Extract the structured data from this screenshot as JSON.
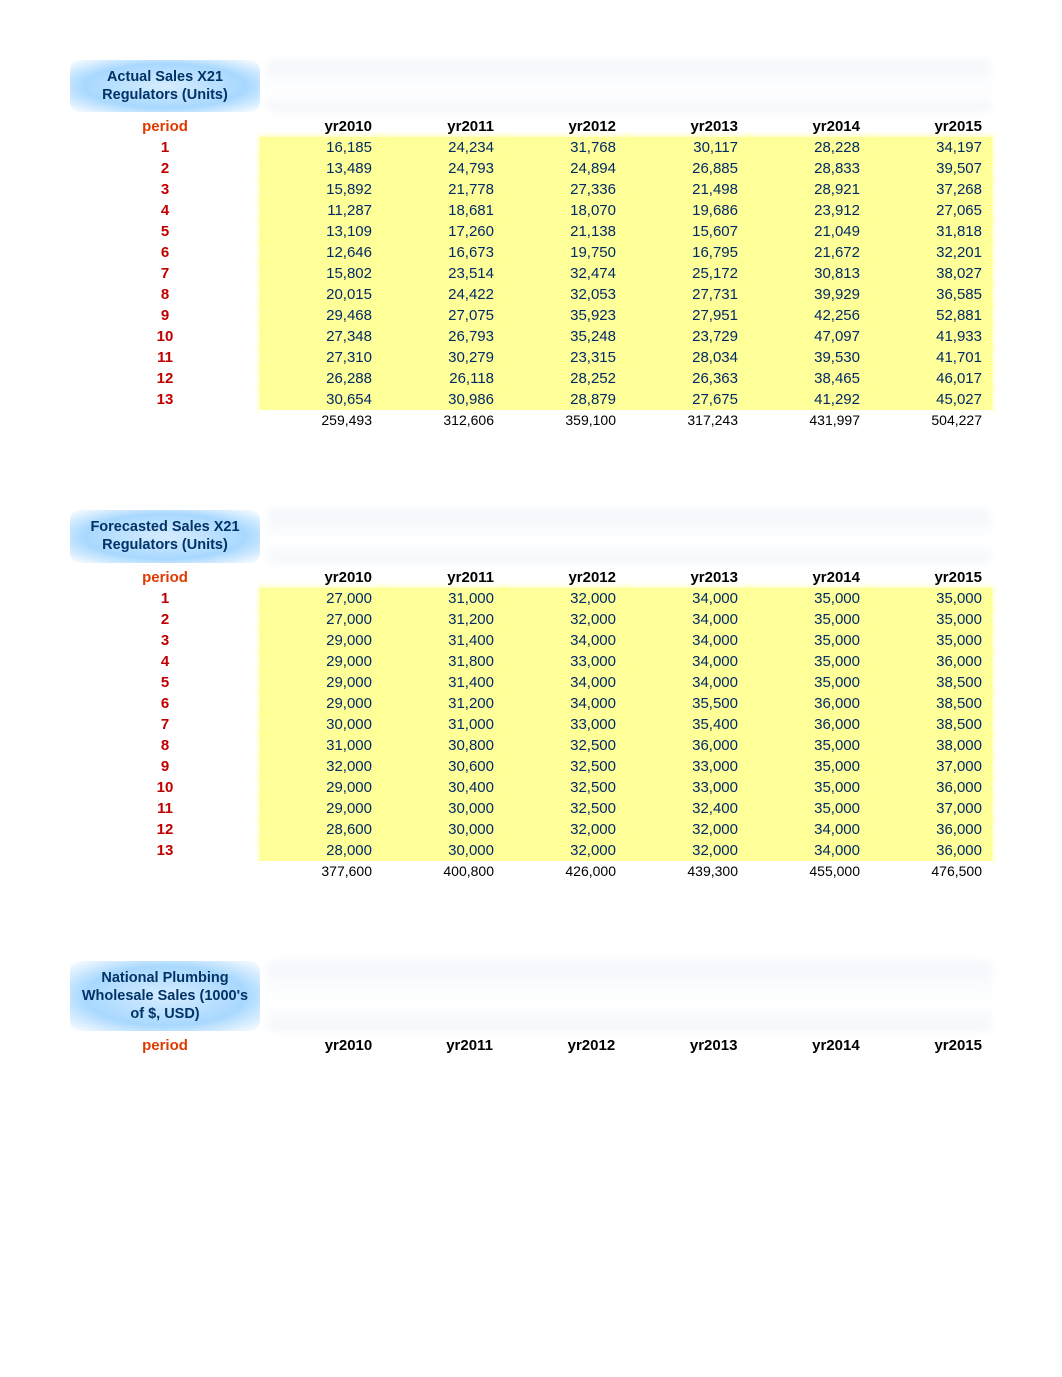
{
  "tables": [
    {
      "title": "Actual Sales X21 Regulators (Units)",
      "period_label": "period",
      "years": [
        "yr2010",
        "yr2011",
        "yr2012",
        "yr2013",
        "yr2014",
        "yr2015"
      ],
      "rows": [
        {
          "period": "1",
          "vals": [
            "16,185",
            "24,234",
            "31,768",
            "30,117",
            "28,228",
            "34,197"
          ]
        },
        {
          "period": "2",
          "vals": [
            "13,489",
            "24,793",
            "24,894",
            "26,885",
            "28,833",
            "39,507"
          ]
        },
        {
          "period": "3",
          "vals": [
            "15,892",
            "21,778",
            "27,336",
            "21,498",
            "28,921",
            "37,268"
          ]
        },
        {
          "period": "4",
          "vals": [
            "11,287",
            "18,681",
            "18,070",
            "19,686",
            "23,912",
            "27,065"
          ]
        },
        {
          "period": "5",
          "vals": [
            "13,109",
            "17,260",
            "21,138",
            "15,607",
            "21,049",
            "31,818"
          ]
        },
        {
          "period": "6",
          "vals": [
            "12,646",
            "16,673",
            "19,750",
            "16,795",
            "21,672",
            "32,201"
          ]
        },
        {
          "period": "7",
          "vals": [
            "15,802",
            "23,514",
            "32,474",
            "25,172",
            "30,813",
            "38,027"
          ]
        },
        {
          "period": "8",
          "vals": [
            "20,015",
            "24,422",
            "32,053",
            "27,731",
            "39,929",
            "36,585"
          ]
        },
        {
          "period": "9",
          "vals": [
            "29,468",
            "27,075",
            "35,923",
            "27,951",
            "42,256",
            "52,881"
          ]
        },
        {
          "period": "10",
          "vals": [
            "27,348",
            "26,793",
            "35,248",
            "23,729",
            "47,097",
            "41,933"
          ]
        },
        {
          "period": "11",
          "vals": [
            "27,310",
            "30,279",
            "23,315",
            "28,034",
            "39,530",
            "41,701"
          ]
        },
        {
          "period": "12",
          "vals": [
            "26,288",
            "26,118",
            "28,252",
            "26,363",
            "38,465",
            "46,017"
          ]
        },
        {
          "period": "13",
          "vals": [
            "30,654",
            "30,986",
            "28,879",
            "27,675",
            "41,292",
            "45,027"
          ]
        }
      ],
      "totals": [
        "259,493",
        "312,606",
        "359,100",
        "317,243",
        "431,997",
        "504,227"
      ]
    },
    {
      "title": "Forecasted Sales X21 Regulators (Units)",
      "period_label": "period",
      "years": [
        "yr2010",
        "yr2011",
        "yr2012",
        "yr2013",
        "yr2014",
        "yr2015"
      ],
      "rows": [
        {
          "period": "1",
          "vals": [
            "27,000",
            "31,000",
            "32,000",
            "34,000",
            "35,000",
            "35,000"
          ]
        },
        {
          "period": "2",
          "vals": [
            "27,000",
            "31,200",
            "32,000",
            "34,000",
            "35,000",
            "35,000"
          ]
        },
        {
          "period": "3",
          "vals": [
            "29,000",
            "31,400",
            "34,000",
            "34,000",
            "35,000",
            "35,000"
          ]
        },
        {
          "period": "4",
          "vals": [
            "29,000",
            "31,800",
            "33,000",
            "34,000",
            "35,000",
            "36,000"
          ]
        },
        {
          "period": "5",
          "vals": [
            "29,000",
            "31,400",
            "34,000",
            "34,000",
            "35,000",
            "38,500"
          ]
        },
        {
          "period": "6",
          "vals": [
            "29,000",
            "31,200",
            "34,000",
            "35,500",
            "36,000",
            "38,500"
          ]
        },
        {
          "period": "7",
          "vals": [
            "30,000",
            "31,000",
            "33,000",
            "35,400",
            "36,000",
            "38,500"
          ]
        },
        {
          "period": "8",
          "vals": [
            "31,000",
            "30,800",
            "32,500",
            "36,000",
            "35,000",
            "38,000"
          ]
        },
        {
          "period": "9",
          "vals": [
            "32,000",
            "30,600",
            "32,500",
            "33,000",
            "35,000",
            "37,000"
          ]
        },
        {
          "period": "10",
          "vals": [
            "29,000",
            "30,400",
            "32,500",
            "33,000",
            "35,000",
            "36,000"
          ]
        },
        {
          "period": "11",
          "vals": [
            "29,000",
            "30,000",
            "32,500",
            "32,400",
            "35,000",
            "37,000"
          ]
        },
        {
          "period": "12",
          "vals": [
            "28,600",
            "30,000",
            "32,000",
            "32,000",
            "34,000",
            "36,000"
          ]
        },
        {
          "period": "13",
          "vals": [
            "28,000",
            "30,000",
            "32,000",
            "32,000",
            "34,000",
            "36,000"
          ]
        }
      ],
      "totals": [
        "377,600",
        "400,800",
        "426,000",
        "439,300",
        "455,000",
        "476,500"
      ]
    },
    {
      "title": "National Plumbing Wholesale Sales (1000's of $, USD)",
      "period_label": "period",
      "years": [
        "yr2010",
        "yr2011",
        "yr2012",
        "yr2013",
        "yr2014",
        "yr2015"
      ],
      "rows": [],
      "totals": null
    }
  ]
}
